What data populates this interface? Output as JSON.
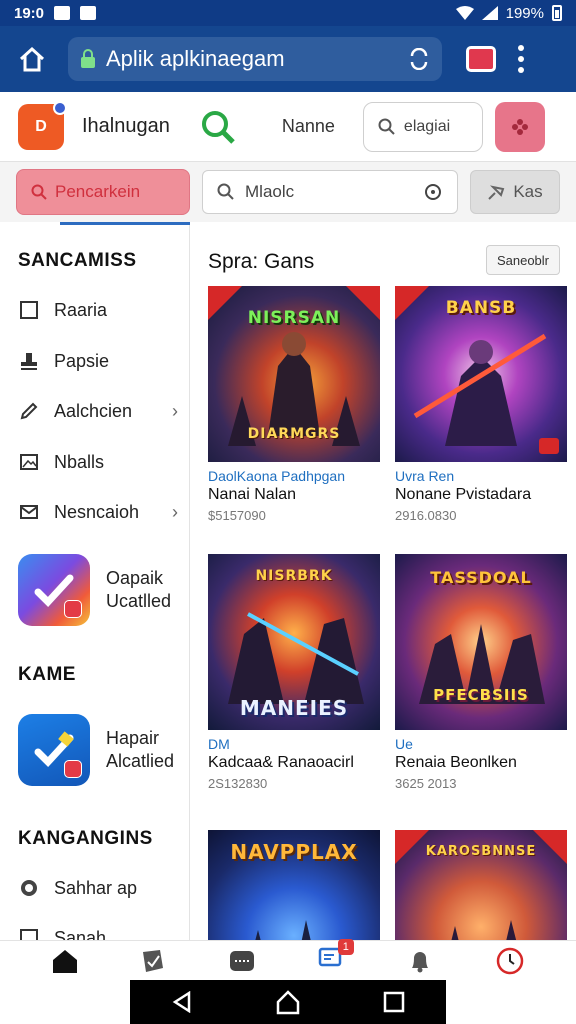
{
  "status": {
    "time": "19:0",
    "battery": "199%"
  },
  "browser": {
    "url": "Aplik aplkinaegam"
  },
  "header": {
    "title": "Ihalnugan",
    "name_label": "Nanne",
    "register_label": "elagiai",
    "logo_text": "D"
  },
  "searchbar": {
    "tab_label": "Pencarkein",
    "input_value": "Mlaolc",
    "button_label": "Kas"
  },
  "sidebar": {
    "section1_title": "SANCAMISS",
    "items": [
      {
        "label": "Raaria",
        "icon": "square-icon"
      },
      {
        "label": "Papsie",
        "icon": "stamp-icon"
      },
      {
        "label": "Aalchcien",
        "icon": "pencil-icon"
      },
      {
        "label": "Nballs",
        "icon": "image-icon"
      },
      {
        "label": "Nesncaioh",
        "icon": "mail-icon"
      }
    ],
    "app1_label": "Oapaik Ucatlled",
    "section2_title": "KAME",
    "app2_label": "Hapair Alcatlied",
    "section3_title": "KANGANGINS",
    "items2": [
      {
        "label": "Sahhar ap",
        "icon": "coin-icon"
      },
      {
        "label": "Sanah",
        "icon": "square-icon"
      }
    ]
  },
  "main": {
    "title": "Spra: Gans",
    "sort_button": "Saneoblr",
    "cards": [
      {
        "art_title": "NISRSAN",
        "art_sub": "DIARMGRS",
        "sub": "DaolKaona Padhpgan",
        "name": "Nanai Nalan",
        "price": "$5157090"
      },
      {
        "art_title": "BANSB",
        "art_sub": "",
        "sub": "Uvra Ren",
        "name": "Nonane Pvistadara",
        "price": "2916.0830"
      },
      {
        "art_title": "NISRBRK",
        "art_sub": "MANEIES",
        "sub": "DM",
        "name": "Kadcaa& Ranaoacirl",
        "price": "2S132830"
      },
      {
        "art_title": "TASSDOAL",
        "art_sub": "PFECBSIIS",
        "sub": "Ue",
        "name": "Renaia Beonlken",
        "price": "3625 2013"
      },
      {
        "art_title": "NAVPPLAX",
        "art_sub": "",
        "sub": "",
        "name": "",
        "price": ""
      },
      {
        "art_title": "KAROSBNNSE",
        "art_sub": "",
        "sub": "",
        "name": "",
        "price": ""
      }
    ]
  },
  "bottom_nav": [
    {
      "icon": "home-icon"
    },
    {
      "icon": "book-icon"
    },
    {
      "icon": "ticket-icon"
    },
    {
      "icon": "messages-icon",
      "badge": "1"
    },
    {
      "icon": "bell-icon"
    },
    {
      "icon": "clock-icon"
    }
  ],
  "colors": {
    "primary": "#14468f",
    "accent_pink": "#ef8f99",
    "link": "#1f6fc0"
  }
}
